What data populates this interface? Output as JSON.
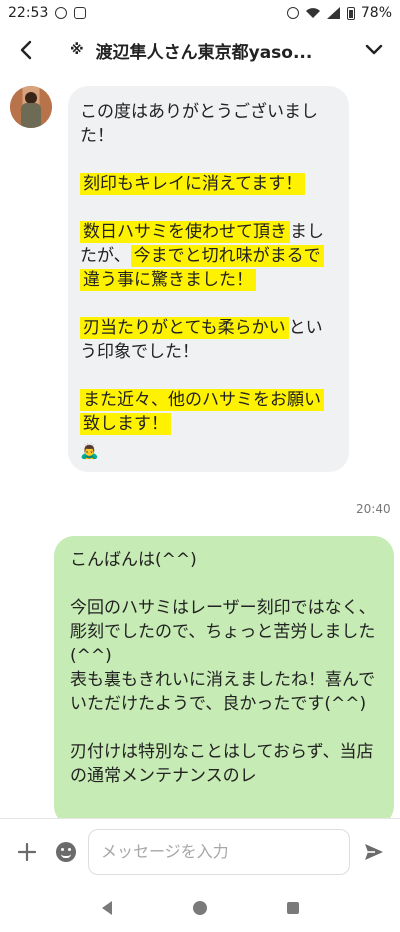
{
  "status_bar": {
    "time": "22:53",
    "battery": "78%"
  },
  "header": {
    "title_mark": "※",
    "title": "渡辺隼人さん東京都yaso..."
  },
  "incoming": {
    "paragraphs": [
      {
        "segments": [
          {
            "text": "この度はありがとうございました！",
            "hl": false
          }
        ]
      },
      {
        "segments": [
          {
            "text": "刻印もキレイに消えてます！",
            "hl": true
          }
        ]
      },
      {
        "segments": [
          {
            "text": "数日ハサミを使わせて頂き",
            "hl": true
          },
          {
            "text": "ましたが、",
            "hl": false
          },
          {
            "text": "今までと切れ味がまるで違う事に驚きました！",
            "hl": true
          }
        ]
      },
      {
        "segments": [
          {
            "text": "刃当たりがとても柔らかい",
            "hl": true
          },
          {
            "text": "という印象でした！",
            "hl": false
          }
        ]
      },
      {
        "segments": [
          {
            "text": "また近々、他のハサミをお願い致します！",
            "hl": true
          }
        ]
      }
    ],
    "emoji": "🙇‍♂️",
    "time": "20:40"
  },
  "outgoing": {
    "paragraphs": [
      "こんばんは(^^)",
      "今回のハサミはレーザー刻印ではなく、彫刻でしたので、ちょっと苦労しました(^^)\n表も裏もきれいに消えましたね！喜んでいただけたようで、良かったです(^^)",
      "刃付けは特別なことはしておらず、当店の通常メンテナンスのレ"
    ]
  },
  "input": {
    "placeholder": "メッセージを入力"
  },
  "icons": {
    "back": "back-arrow-icon",
    "chevron": "chevron-down-icon",
    "plus": "plus-icon",
    "emoji": "emoji-icon",
    "send": "send-icon"
  }
}
